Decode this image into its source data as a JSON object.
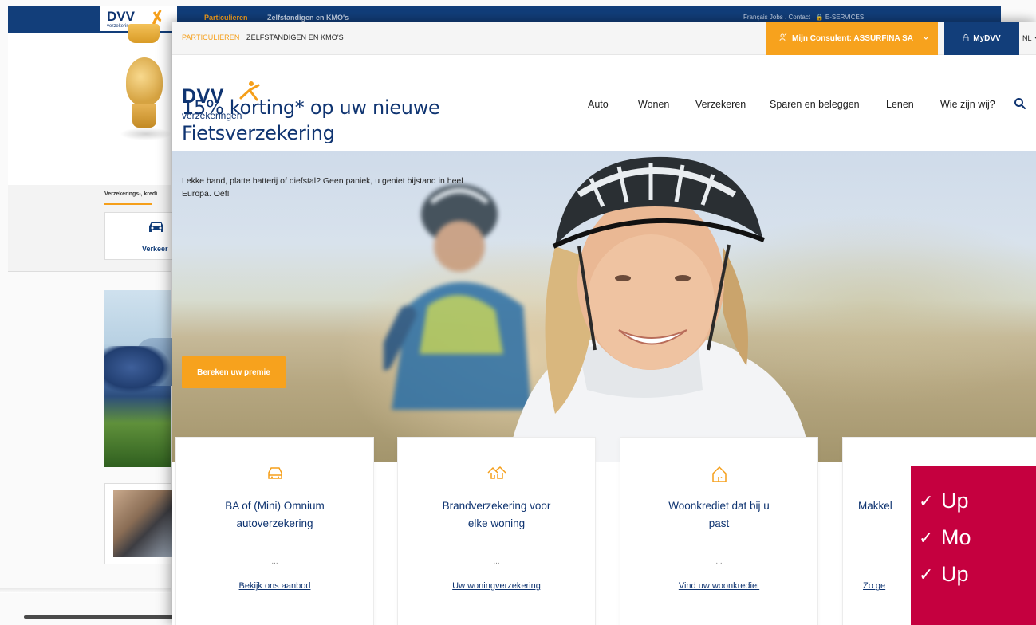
{
  "background_screenshot": {
    "logo_text": "DVV",
    "logo_sub": "verzekeringen",
    "nav_tabs": [
      "Particulieren",
      "Zelfstandigen en KMO's"
    ],
    "top_links": "Français   Jobs  .  Contact  .   🔒 E-SERVICES",
    "section_heading": "Verzekerings-, kredi",
    "card_label": "Verkeer"
  },
  "topbar": {
    "segment_particulieren": "PARTICULIEREN",
    "segment_zelfstandigen": "ZELFSTANDIGEN EN KMO'S",
    "consultant_label": "Mijn Consulent: ASSURFINA SA",
    "mydvv_label": "MyDVV",
    "language": "NL"
  },
  "header": {
    "logo_text": "DVV",
    "logo_sub": "verzekeringen",
    "nav_items": [
      "Auto",
      "Wonen",
      "Verzekeren",
      "Sparen en beleggen",
      "Lenen",
      "Wie zijn wij?"
    ]
  },
  "hero": {
    "title_line1": "15% korting* op uw nieuwe",
    "title_line2": "Fietsverzekering",
    "text_line1": "Lekke band, platte batterij of diefstal? Geen paniek, u geniet bijstand in heel",
    "text_line2": "Europa. Oef!",
    "button_label": "Bereken uw premie"
  },
  "cards": [
    {
      "icon": "car-icon",
      "title_line1": "BA of (Mini) Omnium",
      "title_line2": "autoverzekering",
      "dots": "...",
      "link": "Bekijk ons aanbod"
    },
    {
      "icon": "houses-icon",
      "title_line1": "Brandverzekering voor",
      "title_line2": "elke woning",
      "dots": "...",
      "link": "Uw woningverzekering"
    },
    {
      "icon": "house-icon",
      "title_line1": "Woonkrediet dat bij u",
      "title_line2": "past",
      "dots": "...",
      "link": "Vind uw woonkrediet"
    },
    {
      "icon": "piggy-icon",
      "title_line1": "Makkel",
      "title_line2": "",
      "dots": "",
      "link": "Zo ge"
    }
  ],
  "checklist": {
    "items": [
      "Up",
      "Mo",
      "Up"
    ],
    "check": "✓"
  },
  "colors": {
    "brand_blue": "#0f3471",
    "accent_orange": "#f7a21d",
    "overlay_red": "#c5003f"
  }
}
